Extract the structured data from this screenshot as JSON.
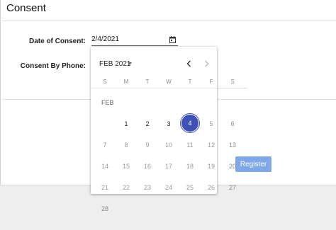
{
  "header": {
    "title": "Consent"
  },
  "form": {
    "date_label": "Date of Consent:",
    "date_value": "2/4/2021",
    "phone_label": "Consent By Phone:",
    "register_label": "Register"
  },
  "calendar": {
    "month_select": "FEB 2021",
    "month_label": "FEB",
    "weekdays": [
      "S",
      "M",
      "T",
      "W",
      "T",
      "F",
      "S"
    ],
    "week1": [
      "1",
      "2",
      "3",
      "4",
      "5",
      "6"
    ],
    "week2": [
      "7",
      "8",
      "9",
      "10",
      "11",
      "12",
      "13"
    ],
    "week3": [
      "14",
      "15",
      "16",
      "17",
      "18",
      "19",
      "20"
    ],
    "week4": [
      "21",
      "22",
      "23",
      "24",
      "25",
      "26",
      "27"
    ],
    "week5": [
      "28"
    ],
    "selected_day": "4",
    "accent_color": "#3f51b5"
  },
  "icons": {
    "calendar": "calendar-icon",
    "prev": "chevron-left-icon",
    "next": "chevron-right-icon",
    "dropdown": "caret-down-icon"
  },
  "colors": {
    "register_button": "#7fa8e9"
  }
}
